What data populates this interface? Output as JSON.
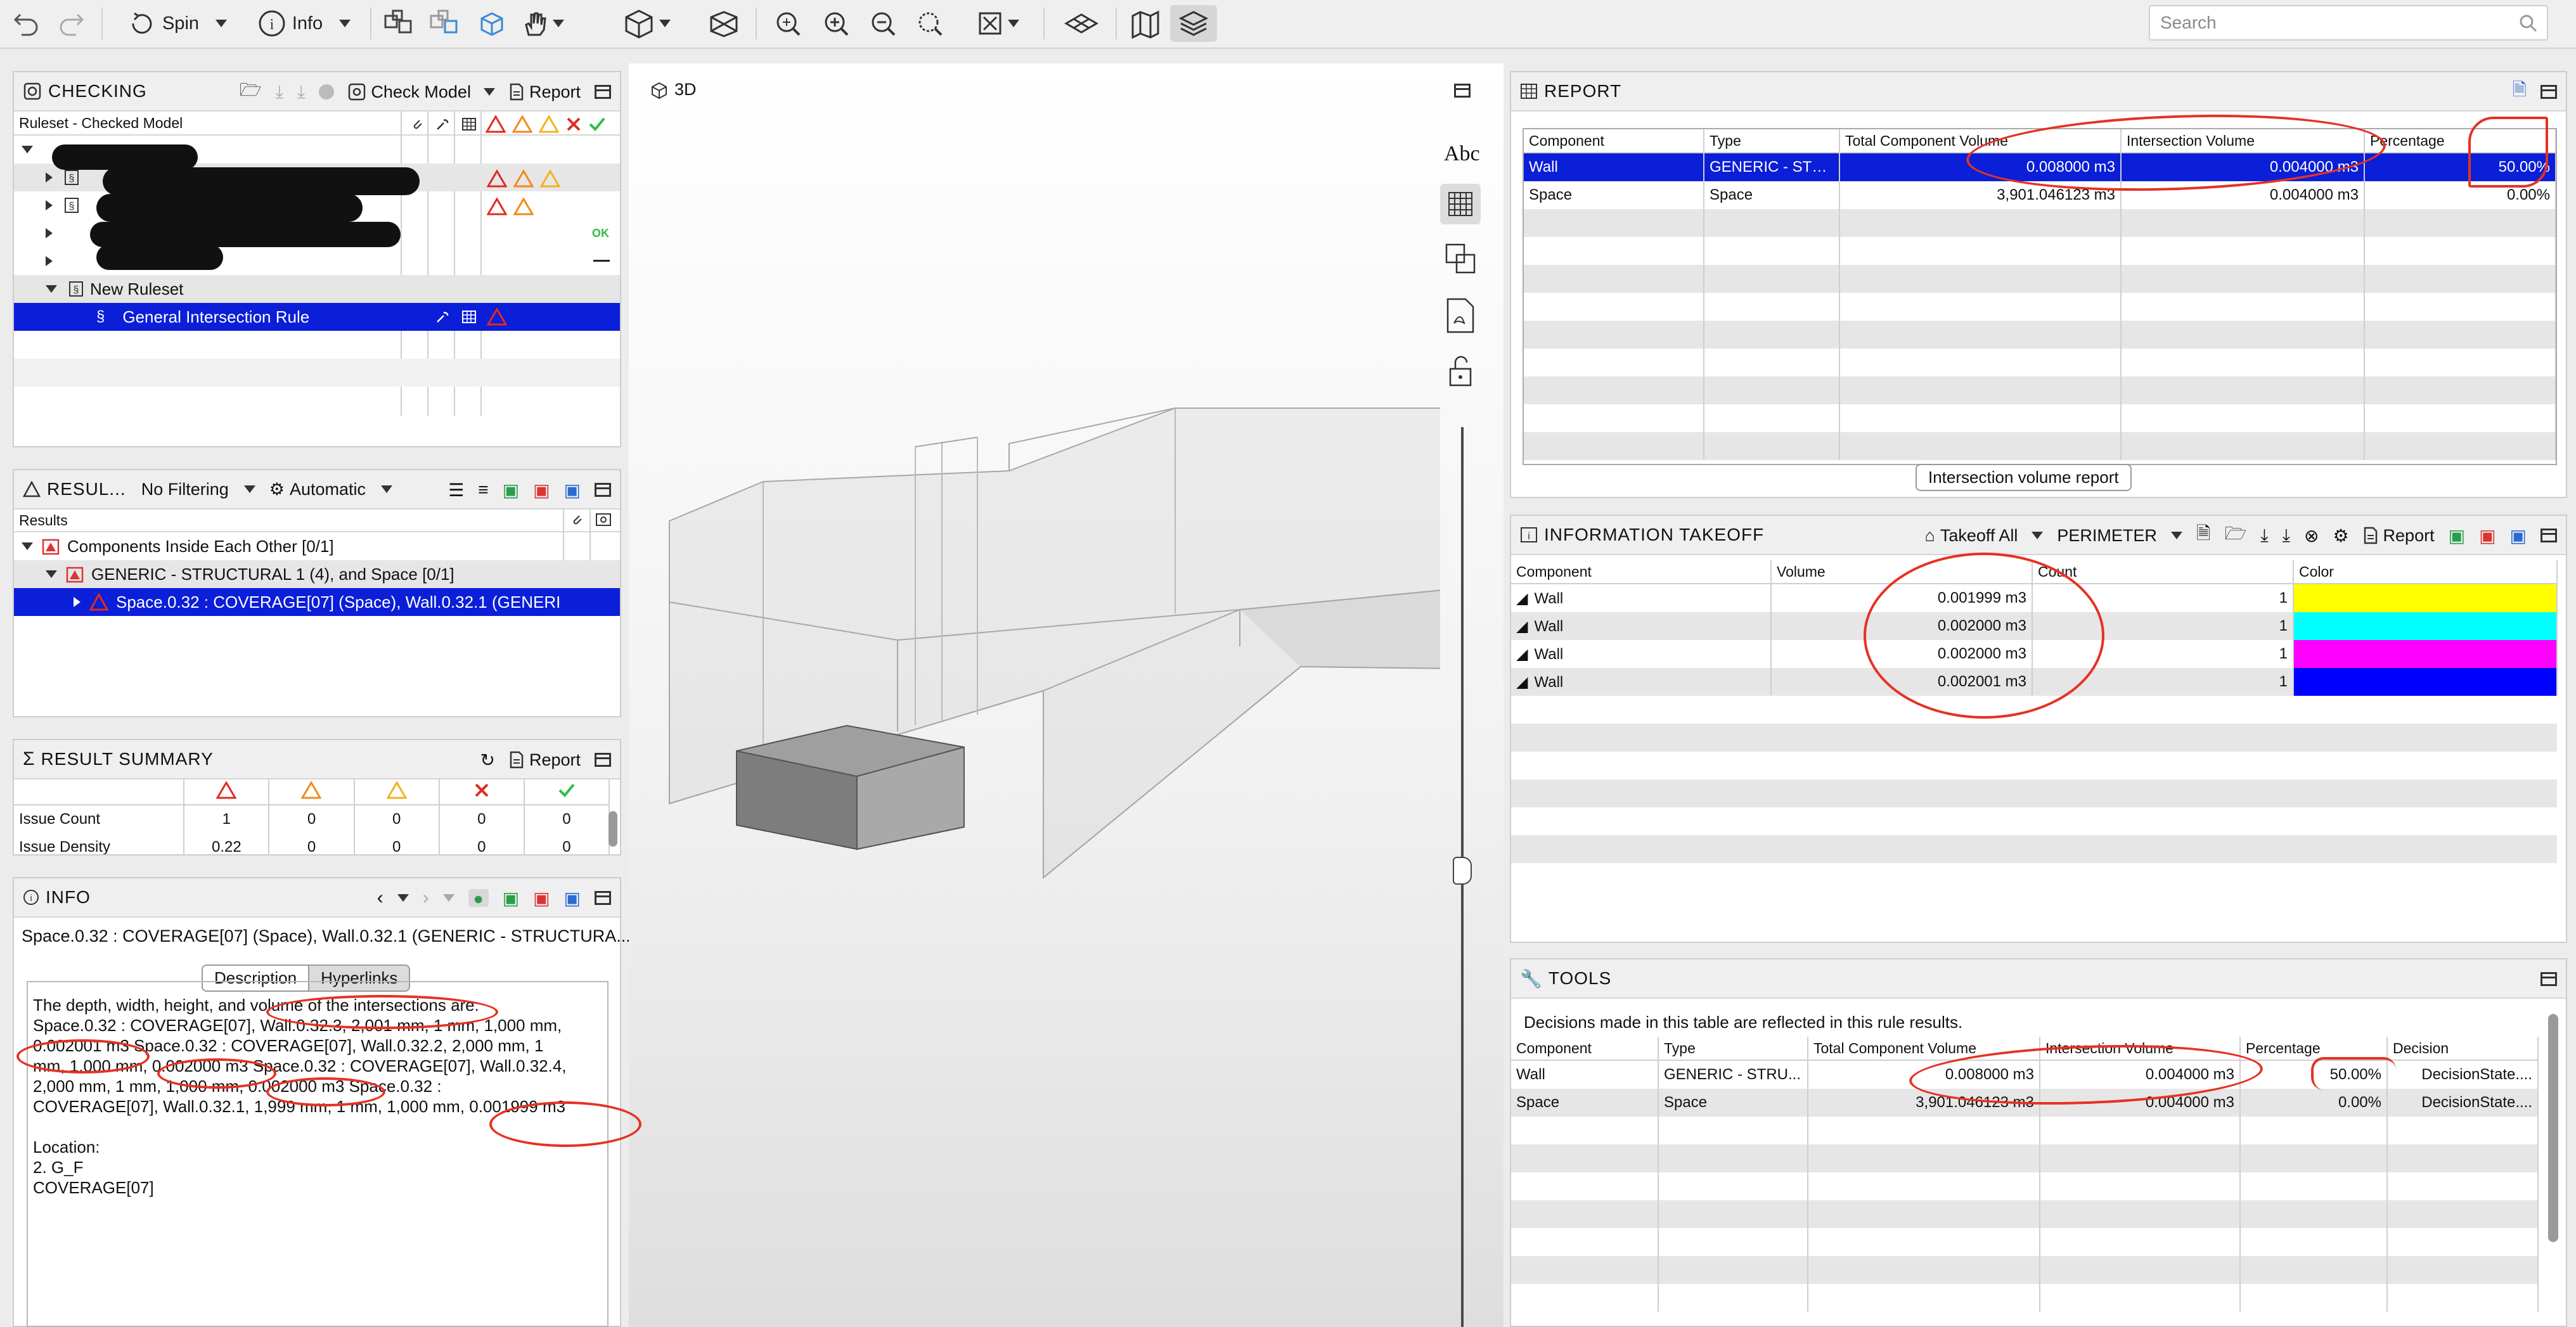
{
  "toolbar": {
    "spin_label": "Spin",
    "info_label": "Info",
    "search_placeholder": "Search"
  },
  "checking": {
    "title": "CHECKING",
    "check_model_label": "Check Model",
    "report_label": "Report",
    "tree_header": "Ruleset - Checked Model",
    "rows": [
      {
        "label": "New Ruleset"
      },
      {
        "label": "General Intersection Rule"
      }
    ],
    "ok_badge": "OK"
  },
  "results": {
    "title": "RESUL...",
    "filter_label": "No Filtering",
    "mode_label": "Automatic",
    "column_header": "Results",
    "items": [
      "Components Inside Each Other [0/1]",
      "GENERIC - STRUCTURAL 1 (4), and Space [0/1]",
      "Space.0.32 : COVERAGE[07] (Space), Wall.0.32.1 (GENERIC"
    ]
  },
  "result_summary": {
    "title": "RESULT SUMMARY",
    "report_label": "Report",
    "rows": [
      {
        "label": "Issue Count",
        "values": [
          "1",
          "0",
          "0",
          "0",
          "0"
        ]
      },
      {
        "label": "Issue Density",
        "values": [
          "0.22",
          "0",
          "0",
          "0",
          "0"
        ]
      }
    ]
  },
  "info": {
    "title": "INFO",
    "subtitle": "Space.0.32 : COVERAGE[07] (Space), Wall.0.32.1 (GENERIC - STRUCTURA...",
    "tab_description": "Description",
    "tab_hyperlinks": "Hyperlinks",
    "body_lines": [
      "The depth, width, height, and volume of the intersections are:",
      "Space.0.32 : COVERAGE[07], Wall.0.32.3, 2,001 mm, 1 mm, 1,000 mm,",
      "0.002001 m3 Space.0.32 : COVERAGE[07], Wall.0.32.2, 2,000 mm, 1",
      "mm, 1,000 mm, 0.002000 m3 Space.0.32 : COVERAGE[07], Wall.0.32.4,",
      "2,000 mm, 1 mm, 1,000 mm, 0.002000 m3 Space.0.32 :",
      "COVERAGE[07], Wall.0.32.1, 1,999 mm, 1 mm, 1,000 mm, 0.001999 m3",
      "",
      "Location:",
      "2. G_F",
      "COVERAGE[07]"
    ]
  },
  "view3d": {
    "title": "3D",
    "abc_label": "Abc"
  },
  "report": {
    "title": "REPORT",
    "columns": [
      "Component",
      "Type",
      "Total Component Volume",
      "Intersection Volume",
      "Percentage"
    ],
    "rows": [
      [
        "Wall",
        "GENERIC - STR...",
        "0.008000 m3",
        "0.004000 m3",
        "50.00%"
      ],
      [
        "Space",
        "Space",
        "3,901.046123 m3",
        "0.004000 m3",
        "0.00%"
      ]
    ],
    "footer_tab": "Intersection volume report"
  },
  "takeoff": {
    "title": "INFORMATION TAKEOFF",
    "takeoff_all_label": "Takeoff All",
    "perimeter_label": "PERIMETER",
    "report_label": "Report",
    "columns": [
      "Component",
      "Volume",
      "Count",
      "Color"
    ],
    "rows": [
      {
        "component": "Wall",
        "volume": "0.001999 m3",
        "count": "1",
        "color": "#ffff00"
      },
      {
        "component": "Wall",
        "volume": "0.002000 m3",
        "count": "1",
        "color": "#00ffff"
      },
      {
        "component": "Wall",
        "volume": "0.002000 m3",
        "count": "1",
        "color": "#ff00ff"
      },
      {
        "component": "Wall",
        "volume": "0.002001 m3",
        "count": "1",
        "color": "#0000ff"
      }
    ]
  },
  "tools": {
    "title": "TOOLS",
    "note": "Decisions made in this table are reflected in this rule results.",
    "columns": [
      "Component",
      "Type",
      "Total Component Volume",
      "Intersection Volume",
      "Percentage",
      "Decision"
    ],
    "rows": [
      [
        "Wall",
        "GENERIC - STRU...",
        "0.008000 m3",
        "0.004000 m3",
        "50.00%",
        "DecisionState...."
      ],
      [
        "Space",
        "Space",
        "3,901.046123 m3",
        "0.004000 m3",
        "0.00%",
        "DecisionState...."
      ]
    ]
  }
}
